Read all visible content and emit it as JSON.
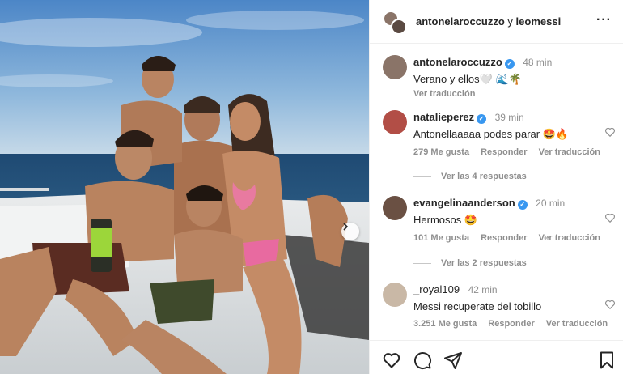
{
  "header": {
    "user1": "antonelaroccuzzo",
    "connector": "y",
    "user2": "leomessi"
  },
  "caption": {
    "username": "antonelaroccuzzo",
    "time": "48 min",
    "text": "Verano y ellos🤍 🌊🌴",
    "translate": "Ver traducción"
  },
  "comments": [
    {
      "username": "natalieperez",
      "verified": true,
      "time": "39 min",
      "text": "Antonellaaaaa podes parar 🤩🔥",
      "likes": "279 Me gusta",
      "reply": "Responder",
      "translate": "Ver traducción",
      "replies": "Ver las 4 respuestas"
    },
    {
      "username": "evangelinaanderson",
      "verified": true,
      "time": "20 min",
      "text": "Hermosos 🤩",
      "likes": "101 Me gusta",
      "reply": "Responder",
      "translate": "Ver traducción",
      "replies": "Ver las 2 respuestas"
    },
    {
      "username": "_royal109",
      "verified": false,
      "time": "42 min",
      "text": "Messi recuperate del tobillo",
      "likes": "3.251 Me gusta",
      "reply": "Responder",
      "translate": "Ver traducción"
    }
  ],
  "icons": {
    "next": "chevron-right-icon",
    "more": "more-horizontal-icon",
    "like": "heart-icon",
    "comment": "comment-icon",
    "share": "send-icon",
    "save": "bookmark-icon"
  },
  "colors": {
    "verified": "#3897f0",
    "muted": "#8e8e8e",
    "text": "#262626"
  }
}
